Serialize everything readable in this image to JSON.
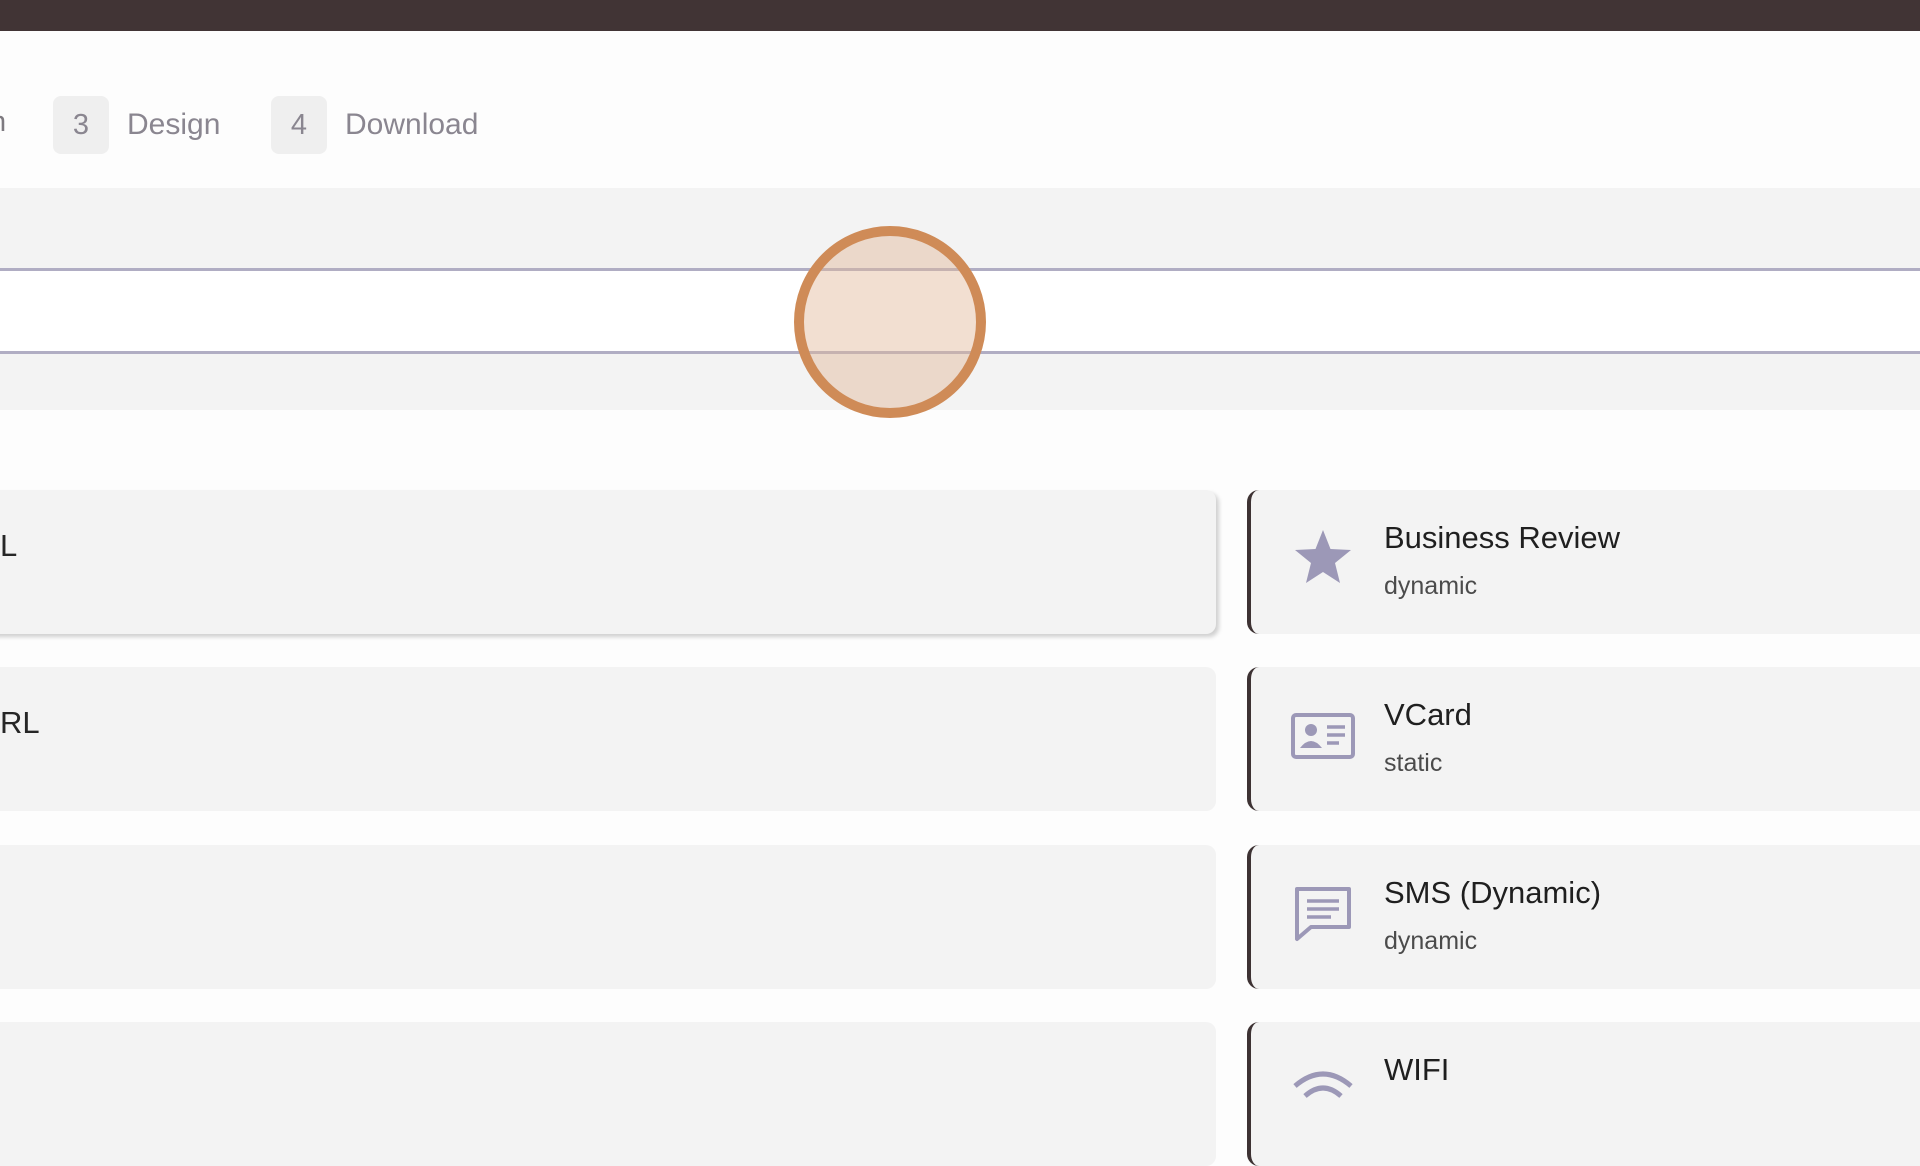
{
  "steps": {
    "partial_label": "n",
    "items": [
      {
        "number": "3",
        "label": "Design"
      },
      {
        "number": "4",
        "label": "Download"
      }
    ]
  },
  "url_input": {
    "value": "",
    "placeholder": ""
  },
  "left_cards": [
    {
      "title_fragment": "L",
      "selected": true
    },
    {
      "title_fragment": "RL",
      "selected": false
    },
    {
      "title_fragment": "",
      "selected": false
    },
    {
      "title_fragment": "",
      "selected": false
    }
  ],
  "right_cards": [
    {
      "icon": "star-icon",
      "title": "Business Review",
      "subtitle": "dynamic"
    },
    {
      "icon": "contact-card-icon",
      "title": "VCard",
      "subtitle": "static"
    },
    {
      "icon": "message-icon",
      "title": "SMS (Dynamic)",
      "subtitle": "dynamic"
    },
    {
      "icon": "wifi-icon",
      "title": "WIFI",
      "subtitle": ""
    }
  ],
  "colors": {
    "topbar": "#413435",
    "accent_icon": "#9c98b7",
    "card_border": "#3d3233",
    "cursor_ring": "#cf8b57"
  }
}
